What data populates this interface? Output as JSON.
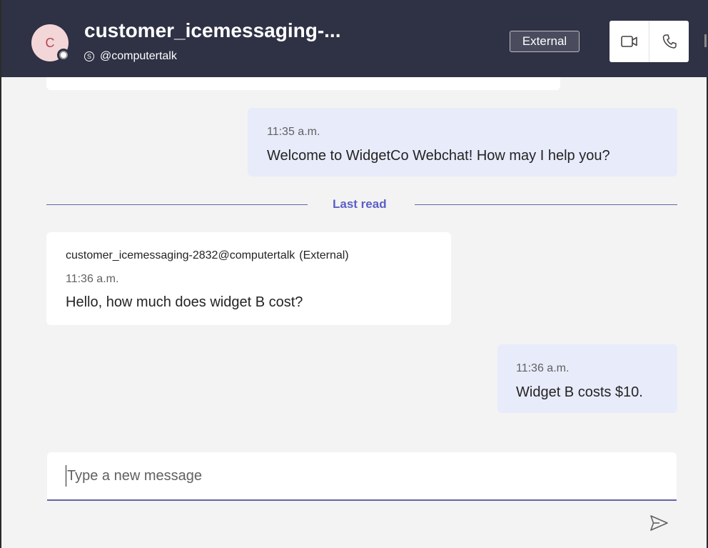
{
  "header": {
    "avatar_initial": "C",
    "title": "customer_icemessaging-...",
    "handle_icon": "skype-icon",
    "handle": "@computertalk",
    "external_badge": "External",
    "video_icon": "video-camera-icon",
    "call_icon": "phone-icon"
  },
  "messages": [
    {
      "direction": "outgoing",
      "time": "11:35 a.m.",
      "text": "Welcome to WidgetCo Webchat! How may I help you?"
    },
    {
      "direction": "incoming",
      "sender": "customer_icemessaging-2832@computertalk",
      "sender_tag": "(External)",
      "time": "11:36 a.m.",
      "text": "Hello, how much does widget B cost?"
    },
    {
      "direction": "outgoing",
      "time": "11:36 a.m.",
      "text": "Widget B costs $10."
    }
  ],
  "divider": {
    "label": "Last read"
  },
  "compose": {
    "placeholder": "Type a new message",
    "value": "",
    "send_icon": "send-icon"
  },
  "colors": {
    "header_bg": "#2f3145",
    "accent": "#6264a7",
    "outgoing_bubble": "#e8ebfa",
    "incoming_bubble": "#ffffff",
    "background": "#f3f3f3"
  }
}
